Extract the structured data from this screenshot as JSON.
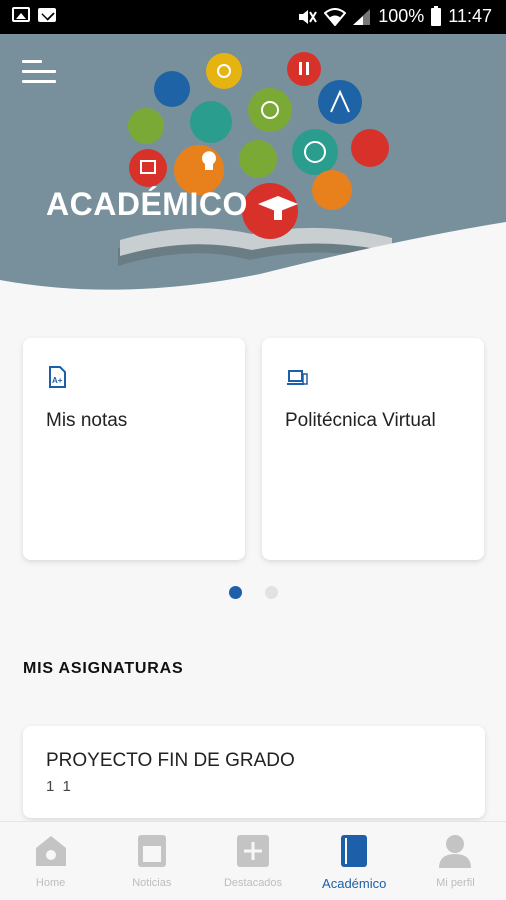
{
  "status_bar": {
    "battery": "100%",
    "time": "11:47"
  },
  "header": {
    "title": "ACADÉMICO"
  },
  "cards": [
    {
      "label": "Mis notas",
      "icon": "grade-document-icon"
    },
    {
      "label": "Politécnica Virtual",
      "icon": "laptop-icon"
    }
  ],
  "carousel": {
    "active_index": 0,
    "count": 2
  },
  "subjects_section": {
    "title": "MIS ASIGNATURAS",
    "items": [
      {
        "name": "PROYECTO FIN DE GRADO",
        "detail": "1 1"
      }
    ]
  },
  "bottom_nav": {
    "items": [
      {
        "label": "Home",
        "icon": "home-icon"
      },
      {
        "label": "Noticias",
        "icon": "news-icon"
      },
      {
        "label": "Destacados",
        "icon": "plus-icon"
      },
      {
        "label": "Académico",
        "icon": "book-icon",
        "active": true
      },
      {
        "label": "Mi perfil",
        "icon": "profile-icon"
      }
    ]
  },
  "colors": {
    "accent": "#1d5fa8",
    "banner": "#78909c",
    "inactive": "#bdbdbd",
    "background": "#f7f7f7"
  }
}
